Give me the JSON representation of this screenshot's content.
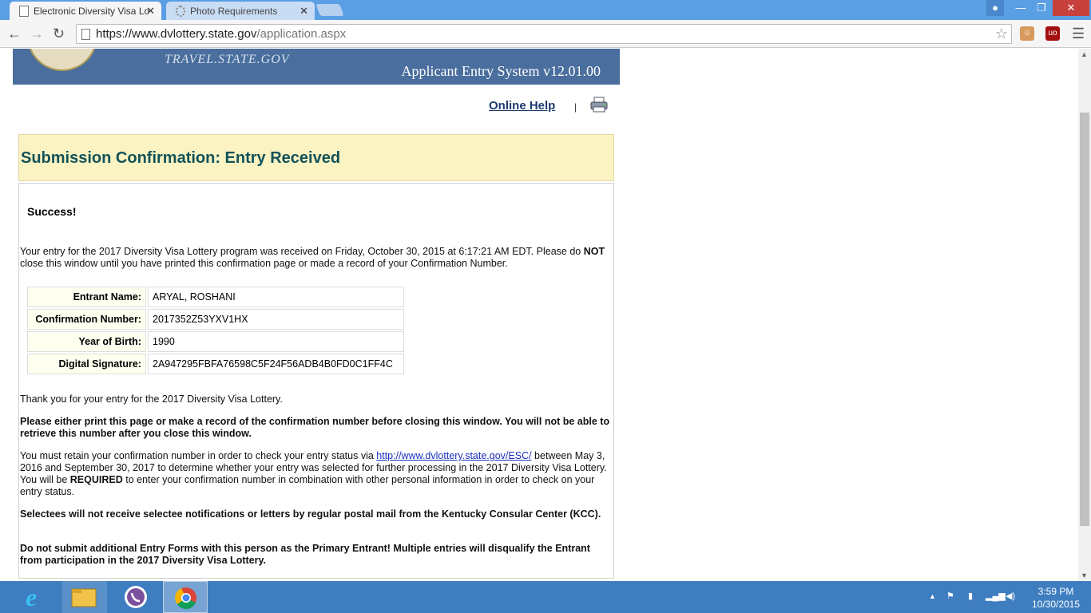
{
  "browser": {
    "tabs": [
      {
        "title": "Electronic Diversity Visa Lo",
        "active": true
      },
      {
        "title": "Photo Requirements",
        "active": false
      }
    ],
    "url_host": "https://www.dvlottery.state.gov",
    "url_path": "/application.aspx"
  },
  "banner": {
    "site_name": "TRAVEL.STATE.GOV",
    "system_title": "Applicant Entry System v12.01.00"
  },
  "header_links": {
    "online_help": "Online Help",
    "separator": "|"
  },
  "confirmation": {
    "heading": "Submission Confirmation: Entry Received",
    "success": "Success!",
    "intro_part1": "Your entry for the 2017 Diversity Visa Lottery program was received on Friday, October 30, 2015 at 6:17:21 AM EDT. Please do ",
    "intro_not": "NOT",
    "intro_part2": " close this window until you have printed this confirmation page or made a record of your Confirmation Number.",
    "fields": [
      {
        "label": "Entrant Name:",
        "value": "ARYAL, ROSHANI"
      },
      {
        "label": "Confirmation Number:",
        "value": "2017352Z53YXV1HX"
      },
      {
        "label": "Year of Birth:",
        "value": "1990"
      },
      {
        "label": "Digital Signature:",
        "value": "2A947295FBFA76598C5F24F56ADB4B0FD0C1FF4C"
      }
    ],
    "thank_you": "Thank you for your entry for the 2017 Diversity Visa Lottery.",
    "print_warning": "Please either print this page or make a record of the confirmation number before closing this window. You will not be able to retrieve this number after you close this window.",
    "retain_part1": "You must retain your confirmation number in order to check your entry status via ",
    "esc_link": "http://www.dvlottery.state.gov/ESC/",
    "retain_part2": " between May 3, 2016 and September 30, 2017 to determine whether your entry was selected for further processing in the 2017 Diversity Visa Lottery. You will be ",
    "retain_required": "REQUIRED",
    "retain_part3": " to enter your confirmation number in combination with other personal information in order to check on your entry status.",
    "mail_notice": "Selectees will not receive selectee notifications or letters by regular postal mail from the Kentucky Consular Center (KCC).",
    "multiple_warning": "Do not submit additional Entry Forms with this person as the Primary Entrant!  Multiple entries will disqualify the Entrant from participation in the 2017 Diversity Visa Lottery."
  },
  "taskbar": {
    "time": "3:59 PM",
    "date": "10/30/2015"
  }
}
